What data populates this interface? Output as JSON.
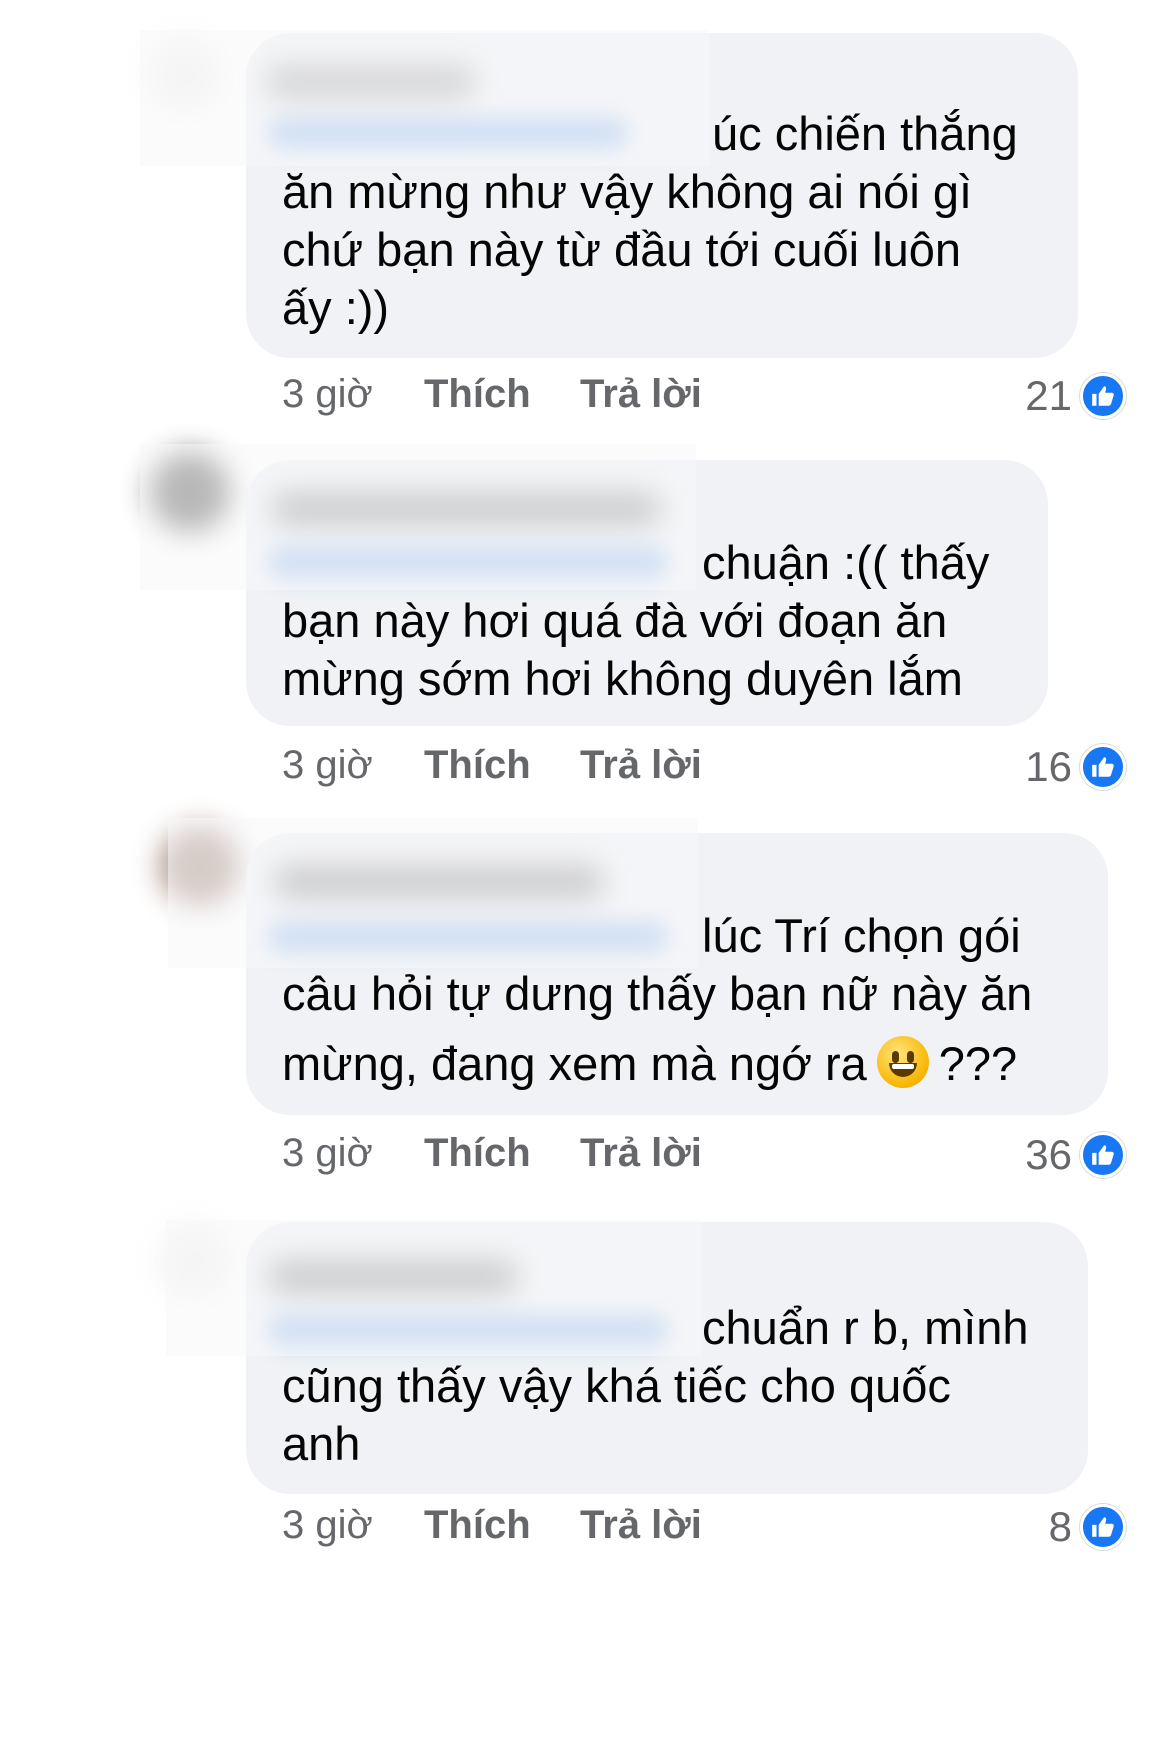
{
  "comments": [
    {
      "line1_tail": "úc chiến thắng",
      "line2": "ăn mừng như vậy không ai nói gì",
      "line3": "chứ bạn này từ đầu tới cuối luôn",
      "line4": "ấy :))",
      "time": "3 giờ",
      "like_label": "Thích",
      "reply_label": "Trả lời",
      "reaction_count": "21",
      "reaction_icon": "like-icon"
    },
    {
      "line1_tail": "chuận :(( thấy",
      "line2": "bạn này hơi quá đà với đoạn ăn",
      "line3": "mừng sớm hơi không duyên lắm",
      "time": "3 giờ",
      "like_label": "Thích",
      "reply_label": "Trả lời",
      "reaction_count": "16",
      "reaction_icon": "like-icon"
    },
    {
      "line1_tail": "lúc Trí chọn gói",
      "line2": "câu hỏi tự dưng thấy bạn nữ này ăn",
      "line3_a": "mừng, đang xem mà ngớ ra",
      "line3_emoji": "grinning-face-emoji",
      "line3_b": "???",
      "time": "3 giờ",
      "like_label": "Thích",
      "reply_label": "Trả lời",
      "reaction_count": "36",
      "reaction_icon": "like-icon"
    },
    {
      "line1_tail": "chuẩn r b, mình",
      "line2": "cũng thấy vậy khá tiếc cho quốc",
      "line3": "anh",
      "time": "3 giờ",
      "like_label": "Thích",
      "reply_label": "Trả lời",
      "reaction_count": "8",
      "reaction_icon": "like-icon"
    }
  ],
  "colors": {
    "bubble": "#f0f2f5",
    "meta_text": "#65676b",
    "like_blue": "#1877f2"
  }
}
